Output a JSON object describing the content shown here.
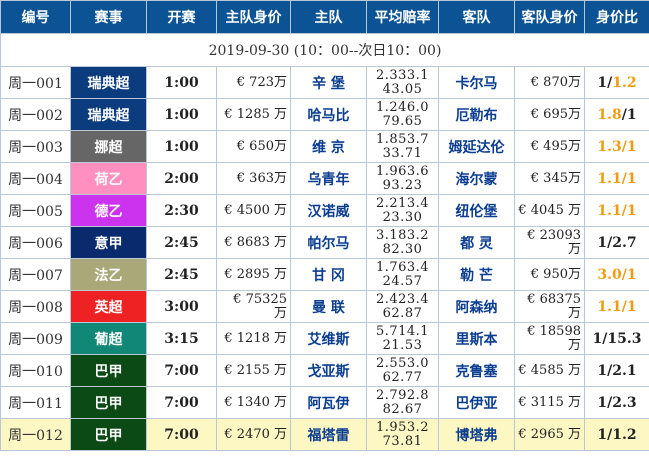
{
  "header": {
    "col_id": "编号",
    "col_league": "赛事",
    "col_kickoff": "开赛",
    "col_home_value": "主队身价",
    "col_home": "主队",
    "col_odds": "平均赔率",
    "col_away": "客队",
    "col_away_value": "客队身价",
    "col_ratio": "身价比"
  },
  "date_line": "2019-09-30 (10：00--次日10：00)",
  "colors": {
    "header_bg": "#0b5394",
    "team_text": "#0b3d91",
    "ratio_highlight": "#f39c12",
    "row_highlight_bg": "#fdf7c3"
  },
  "rows": [
    {
      "id": "周一001",
      "league": "瑞典超",
      "league_color": "#0b3d7e",
      "time": "1:00",
      "home_value": "€ 723万",
      "home": "辛 堡",
      "odds": "2.333.1 43.05",
      "away": "卡尔马",
      "away_value": "€ 870万",
      "ratio_left": "1/",
      "ratio_right": "1.2",
      "ratio_hl": "right",
      "highlight": false
    },
    {
      "id": "周一002",
      "league": "瑞典超",
      "league_color": "#0b3d7e",
      "time": "1:00",
      "home_value": "€ 1285 万",
      "home": "哈马比",
      "odds": "1.246.0 79.65",
      "away": "厄勒布",
      "away_value": "€ 695万",
      "ratio_left": "1.8",
      "ratio_right": "/1",
      "ratio_hl": "left",
      "highlight": false
    },
    {
      "id": "周一003",
      "league": "挪超",
      "league_color": "#666666",
      "time": "1:00",
      "home_value": "€ 650万",
      "home": "维 京",
      "odds": "1.853.7 33.71",
      "away": "姆延达伦",
      "away_value": "€ 495万",
      "ratio_left": "1.3/1",
      "ratio_right": "",
      "ratio_hl": "left",
      "highlight": false
    },
    {
      "id": "周一004",
      "league": "荷乙",
      "league_color": "#ff8fbf",
      "time": "2:00",
      "home_value": "€ 363万",
      "home": "乌青年",
      "odds": "1.963.6 93.23",
      "away": "海尔蒙",
      "away_value": "€ 345万",
      "ratio_left": "1.1/1",
      "ratio_right": "",
      "ratio_hl": "left",
      "highlight": false
    },
    {
      "id": "周一005",
      "league": "德乙",
      "league_color": "#cc33ee",
      "time": "2:30",
      "home_value": "€ 4500 万",
      "home": "汉诺威",
      "odds": "2.213.4 23.30",
      "away": "纽伦堡",
      "away_value": "€ 4045 万",
      "ratio_left": "1.1/1",
      "ratio_right": "",
      "ratio_hl": "left",
      "highlight": false
    },
    {
      "id": "周一006",
      "league": "意甲",
      "league_color": "#0a2a6e",
      "time": "2:45",
      "home_value": "€ 8683 万",
      "home": "帕尔马",
      "odds": "3.183.2 82.30",
      "away": "都 灵",
      "away_value": "€ 23093 万",
      "ratio_left": "1/2.7",
      "ratio_right": "",
      "ratio_hl": "none",
      "highlight": false
    },
    {
      "id": "周一007",
      "league": "法乙",
      "league_color": "#a9a878",
      "time": "2:45",
      "home_value": "€ 2895 万",
      "home": "甘 冈",
      "odds": "1.763.4 24.57",
      "away": "勒 芒",
      "away_value": "€ 950万",
      "ratio_left": "3.0/1",
      "ratio_right": "",
      "ratio_hl": "left",
      "highlight": false
    },
    {
      "id": "周一008",
      "league": "英超",
      "league_color": "#ee2222",
      "time": "3:00",
      "home_value": "€ 75325 万",
      "home": "曼 联",
      "odds": "2.423.4 62.87",
      "away": "阿森纳",
      "away_value": "€ 68375 万",
      "ratio_left": "1.1/1",
      "ratio_right": "",
      "ratio_hl": "left",
      "highlight": false
    },
    {
      "id": "周一009",
      "league": "葡超",
      "league_color": "#118877",
      "time": "3:15",
      "home_value": "€ 1218 万",
      "home": "艾维斯",
      "odds": "5.714.1 21.53",
      "away": "里斯本",
      "away_value": "€ 18598 万",
      "ratio_left": "1/15.3",
      "ratio_right": "",
      "ratio_hl": "none",
      "highlight": false
    },
    {
      "id": "周一010",
      "league": "巴甲",
      "league_color": "#0b4a14",
      "time": "7:00",
      "home_value": "€ 2155 万",
      "home": "戈亚斯",
      "odds": "2.553.0 62.77",
      "away": "克鲁塞",
      "away_value": "€ 4585 万",
      "ratio_left": "1/2.1",
      "ratio_right": "",
      "ratio_hl": "none",
      "highlight": false
    },
    {
      "id": "周一011",
      "league": "巴甲",
      "league_color": "#0b4a14",
      "time": "7:00",
      "home_value": "€ 1340 万",
      "home": "阿瓦伊",
      "odds": "2.792.8 82.67",
      "away": "巴伊亚",
      "away_value": "€ 3115 万",
      "ratio_left": "1/2.3",
      "ratio_right": "",
      "ratio_hl": "none",
      "highlight": false
    },
    {
      "id": "周一012",
      "league": "巴甲",
      "league_color": "#0b4a14",
      "time": "7:00",
      "home_value": "€ 2470 万",
      "home": "福塔雷",
      "odds": "1.953.2 73.81",
      "away": "博塔弗",
      "away_value": "€ 2965 万",
      "ratio_left": "1/1.2",
      "ratio_right": "",
      "ratio_hl": "none",
      "highlight": true
    }
  ]
}
